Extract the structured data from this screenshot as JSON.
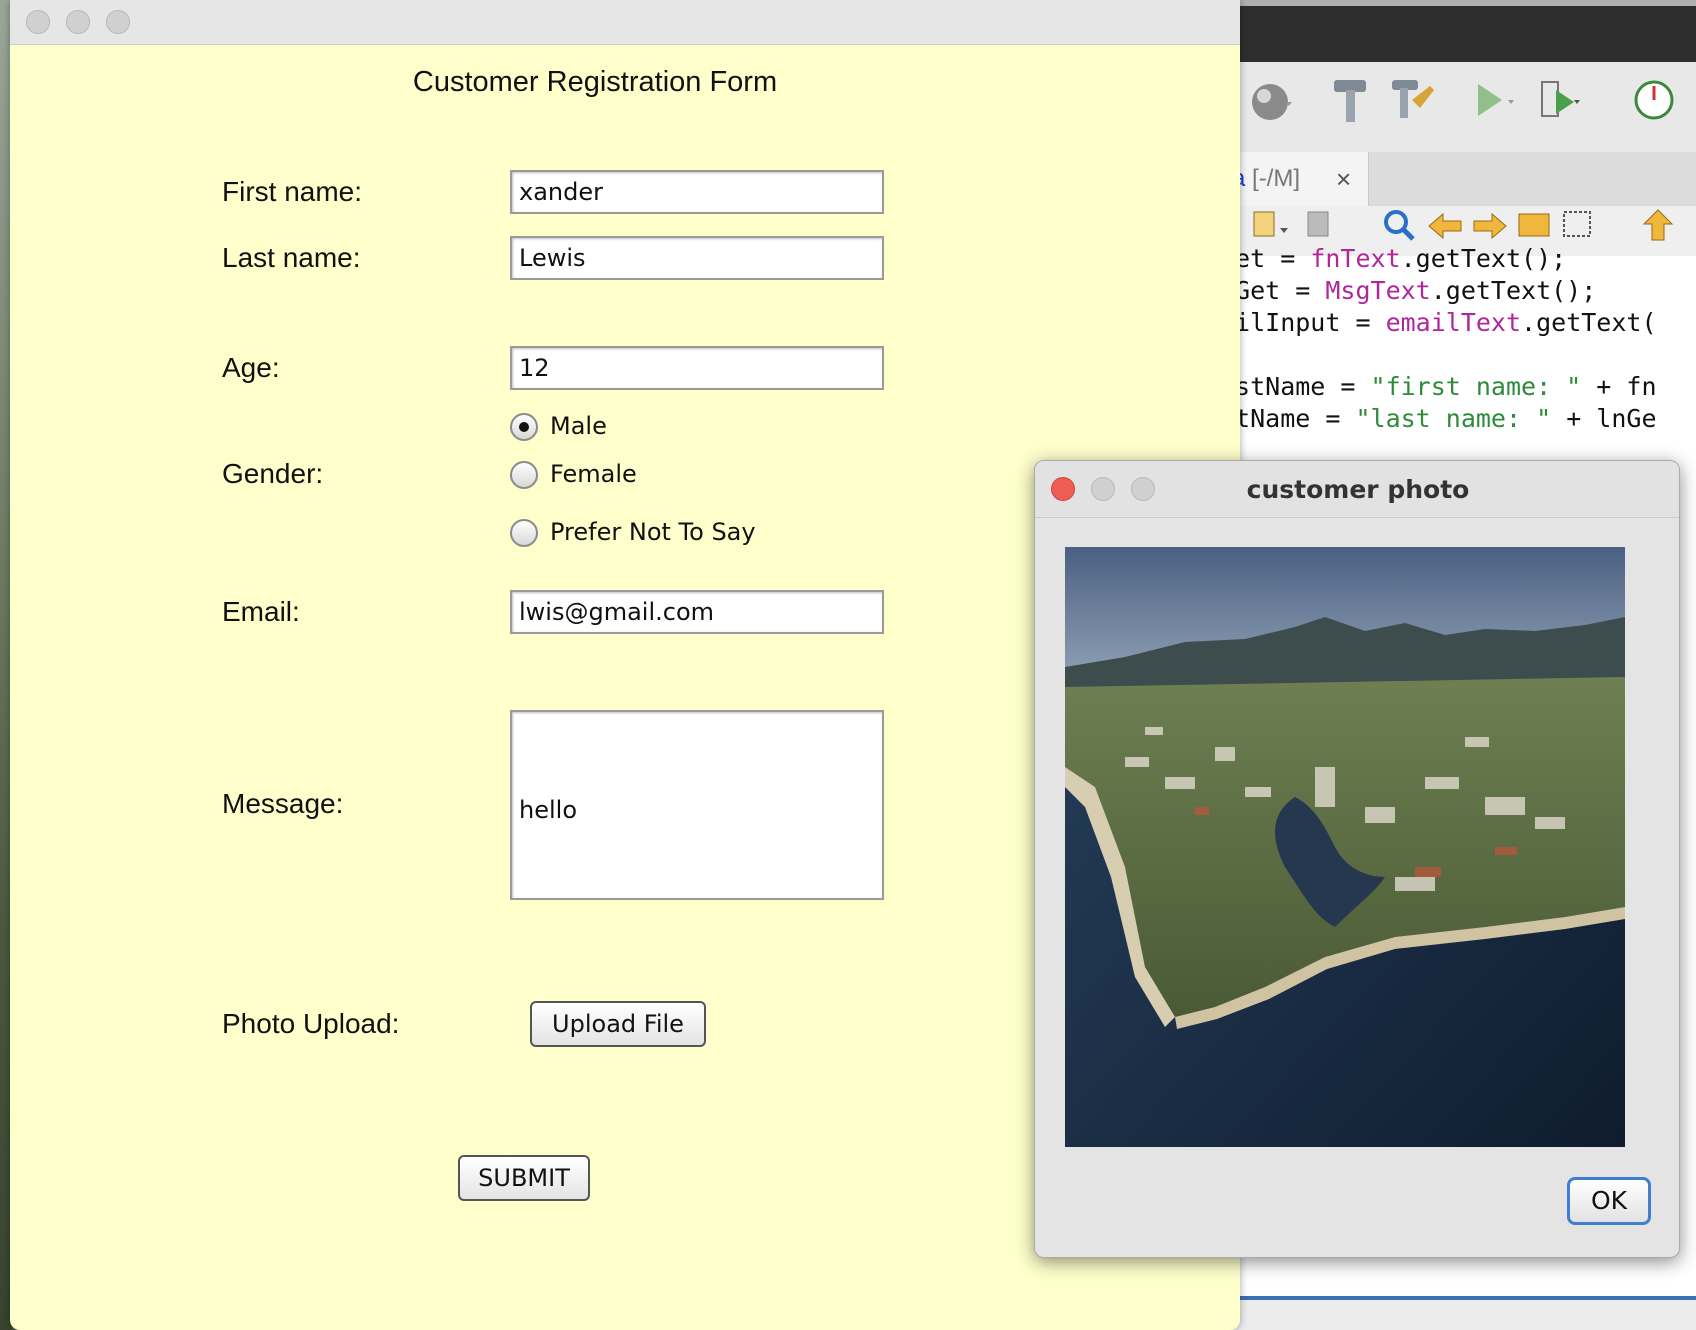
{
  "form": {
    "title": "Customer Registration Form",
    "first_name_label": "First name:",
    "first_name_value": "xander",
    "last_name_label": "Last name:",
    "last_name_value": "Lewis",
    "age_label": "Age:",
    "age_value": "12",
    "gender_label": "Gender:",
    "gender_options": [
      "Male",
      "Female",
      "Prefer Not To Say"
    ],
    "gender_selected": "Male",
    "email_label": "Email:",
    "email_value": "lwis@gmail.com",
    "message_label": "Message:",
    "message_value": "hello",
    "photo_label": "Photo Upload:",
    "upload_button": "Upload File",
    "submit_button": "SUBMIT"
  },
  "dialog": {
    "title": "customer photo",
    "ok_button": "OK"
  },
  "ide": {
    "tab_name": "va",
    "tab_suffix": "[-/M]",
    "tab_close": "×",
    "code": [
      {
        "parts": [
          {
            "t": "Get = ",
            "c": ""
          },
          {
            "t": "fnText",
            "c": "mag"
          },
          {
            "t": ".getText();",
            "c": ""
          }
        ]
      },
      {
        "parts": [
          {
            "t": "gGet = ",
            "c": ""
          },
          {
            "t": "MsgText",
            "c": "mag"
          },
          {
            "t": ".getText();",
            "c": ""
          }
        ]
      },
      {
        "parts": [
          {
            "t": "ailInput = ",
            "c": ""
          },
          {
            "t": "emailText",
            "c": "mag"
          },
          {
            "t": ".getText(",
            "c": ""
          }
        ]
      },
      {
        "parts": [
          {
            "t": "",
            "c": ""
          }
        ]
      },
      {
        "parts": [
          {
            "t": "rstName = ",
            "c": ""
          },
          {
            "t": "\"first name: \"",
            "c": "grn"
          },
          {
            "t": " + fn",
            "c": ""
          }
        ]
      },
      {
        "parts": [
          {
            "t": "stName = ",
            "c": ""
          },
          {
            "t": "\"last name: \"",
            "c": "grn"
          },
          {
            "t": " + lnGe",
            "c": ""
          }
        ]
      }
    ]
  },
  "colors": {
    "form_background": "#ffffcc",
    "dialog_background": "#e4e4e4",
    "ok_button_border": "#3e7fd0",
    "code_string": "#2e8b3a",
    "code_field": "#b0279a"
  }
}
